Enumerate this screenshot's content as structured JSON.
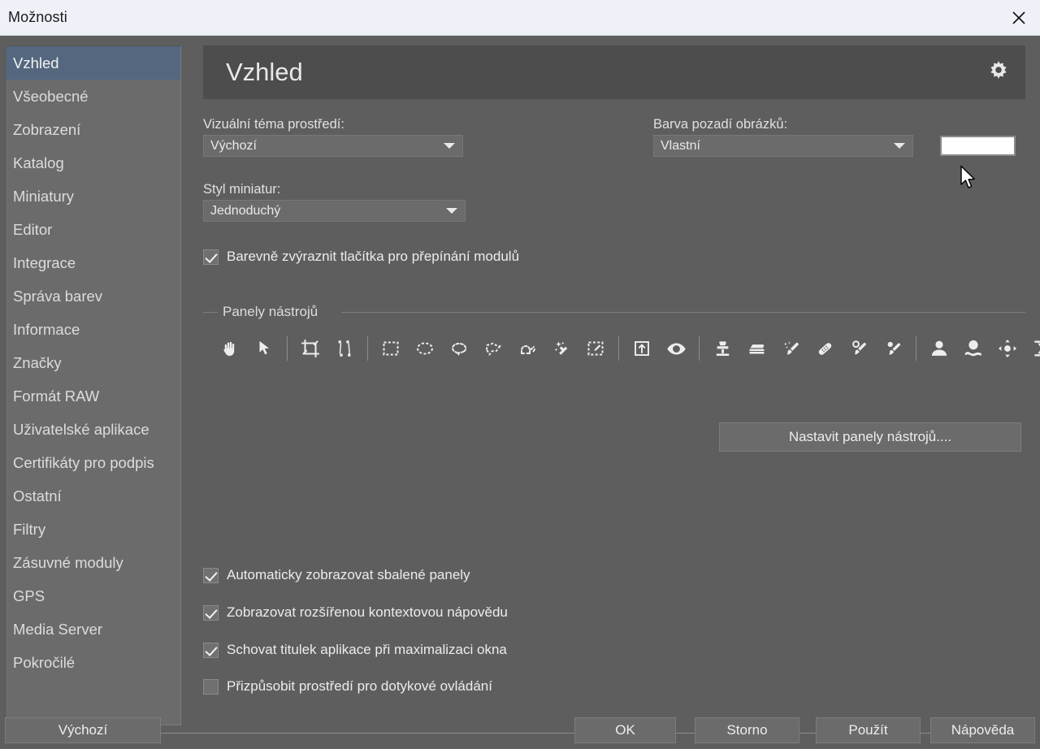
{
  "window": {
    "title": "Možnosti",
    "close_icon": "close-icon"
  },
  "sidebar": {
    "items": [
      {
        "label": "Vzhled",
        "selected": true
      },
      {
        "label": "Všeobecné",
        "selected": false
      },
      {
        "label": "Zobrazení",
        "selected": false
      },
      {
        "label": "Katalog",
        "selected": false
      },
      {
        "label": "Miniatury",
        "selected": false
      },
      {
        "label": "Editor",
        "selected": false
      },
      {
        "label": "Integrace",
        "selected": false
      },
      {
        "label": "Správa barev",
        "selected": false
      },
      {
        "label": "Informace",
        "selected": false
      },
      {
        "label": "Značky",
        "selected": false
      },
      {
        "label": "Formát RAW",
        "selected": false
      },
      {
        "label": "Uživatelské aplikace",
        "selected": false
      },
      {
        "label": "Certifikáty pro podpis",
        "selected": false
      },
      {
        "label": "Ostatní",
        "selected": false
      },
      {
        "label": "Filtry",
        "selected": false
      },
      {
        "label": "Zásuvné moduly",
        "selected": false
      },
      {
        "label": "GPS",
        "selected": false
      },
      {
        "label": "Media Server",
        "selected": false
      },
      {
        "label": "Pokročilé",
        "selected": false
      }
    ]
  },
  "page": {
    "title": "Vzhled",
    "gear_icon": "gear-icon"
  },
  "fields": {
    "theme_label": "Vizuální téma prostředí:",
    "theme_value": "Výchozí",
    "thumb_style_label": "Styl miniatur:",
    "thumb_style_value": "Jednoduchý",
    "image_bg_label": "Barva pozadí obrázků:",
    "image_bg_value": "Vlastní",
    "image_bg_color": "#ffffff"
  },
  "options": {
    "colorize_module_buttons": {
      "label": "Barevně zvýraznit tlačítka pro přepínání modulů",
      "checked": true
    },
    "auto_show_collapsed_panels": {
      "label": "Automaticky zobrazovat sbalené panely",
      "checked": true
    },
    "show_extended_context_help": {
      "label": "Zobrazovat rozšířenou kontextovou nápovědu",
      "checked": true
    },
    "hide_title_on_maximize": {
      "label": "Schovat titulek aplikace při maximalizaci okna",
      "checked": true
    },
    "adapt_for_touch": {
      "label": "Přizpůsobit prostředí pro dotykové ovládání",
      "checked": false
    }
  },
  "toolbars": {
    "group_title": "Panely nástrojů",
    "configure_button": "Nastavit panely nástrojů....",
    "icons": [
      {
        "name": "hand-icon"
      },
      {
        "name": "pointer-icon"
      },
      {
        "separator": true
      },
      {
        "name": "crop-icon"
      },
      {
        "name": "straighten-icon"
      },
      {
        "separator": true
      },
      {
        "name": "rectangle-select-icon"
      },
      {
        "name": "ellipse-select-icon"
      },
      {
        "name": "lasso-select-icon"
      },
      {
        "name": "polygon-lasso-icon"
      },
      {
        "name": "magnetic-lasso-icon"
      },
      {
        "name": "magic-wand-icon"
      },
      {
        "name": "brush-select-icon"
      },
      {
        "separator": true
      },
      {
        "name": "export-selection-icon"
      },
      {
        "name": "eye-icon"
      },
      {
        "separator": true
      },
      {
        "name": "clone-stamp-icon"
      },
      {
        "name": "gradient-icon"
      },
      {
        "name": "effect-brush-icon"
      },
      {
        "name": "healing-patch-icon"
      },
      {
        "name": "spot-heal-icon"
      },
      {
        "name": "retouch-brush-icon"
      },
      {
        "separator": true
      },
      {
        "name": "portrait-icon"
      },
      {
        "name": "skin-smooth-icon"
      },
      {
        "name": "liquify-move-icon"
      },
      {
        "name": "warp-transform-icon"
      }
    ]
  },
  "footer": {
    "defaults": "Výchozí",
    "ok": "OK",
    "cancel": "Storno",
    "apply": "Použít",
    "help": "Nápověda"
  },
  "colors": {
    "window_bg": "#5e5e5e",
    "titlebar_bg": "#eef1f7",
    "header_bg": "#4d4d4d",
    "sidebar_bg": "#6b6b6b",
    "sidebar_selected": "#55677f",
    "control_bg": "#6b6b6b",
    "text": "#e8e8e8"
  }
}
